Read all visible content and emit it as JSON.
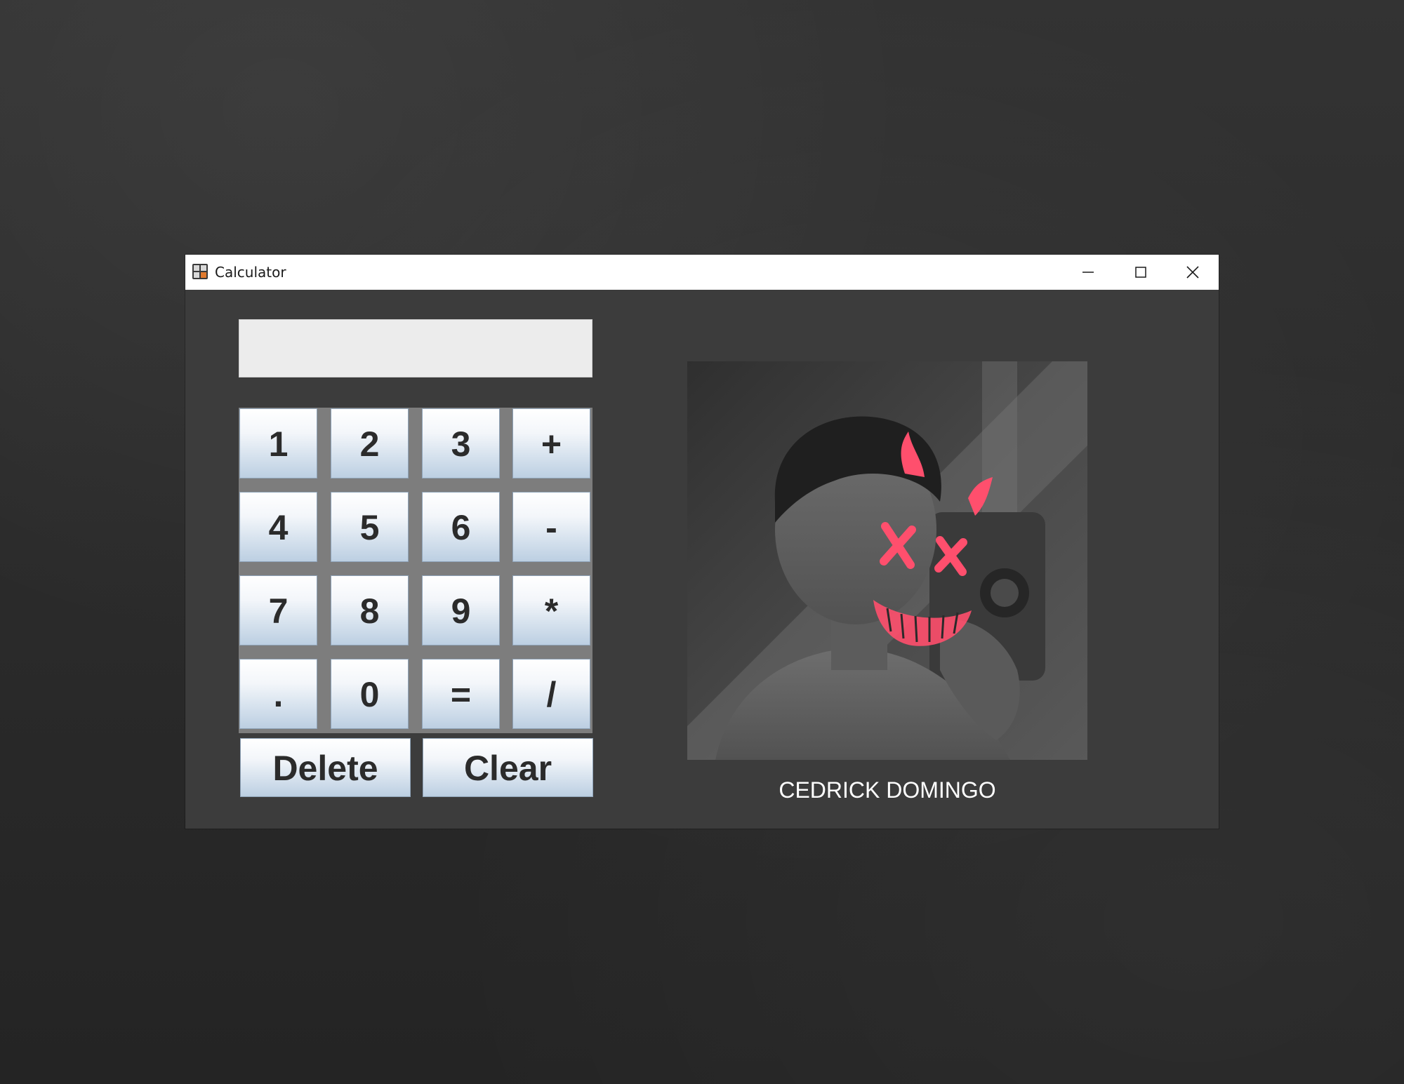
{
  "window": {
    "title": "Calculator",
    "app_icon": "calculator-icon",
    "controls": {
      "minimize_icon": "minimize-icon",
      "maximize_icon": "maximize-icon",
      "close_icon": "close-icon"
    }
  },
  "display": {
    "value": ""
  },
  "keypad": {
    "rows": [
      [
        "1",
        "2",
        "3",
        "+"
      ],
      [
        "4",
        "5",
        "6",
        "-"
      ],
      [
        "7",
        "8",
        "9",
        "*"
      ],
      [
        ".",
        "0",
        "=",
        "/"
      ]
    ],
    "delete_label": "Delete",
    "clear_label": "Clear"
  },
  "profile": {
    "name": "CEDRICK DOMINGO",
    "photo_description_icon": "profile-photo"
  },
  "colors": {
    "window_background": "#3c3c3c",
    "keypad_background": "#7d7d7d",
    "display_background": "#ececec",
    "caption_text": "#ffffff",
    "titlebar": "#ffffff",
    "accent_overlay": "#ff4f6d"
  }
}
